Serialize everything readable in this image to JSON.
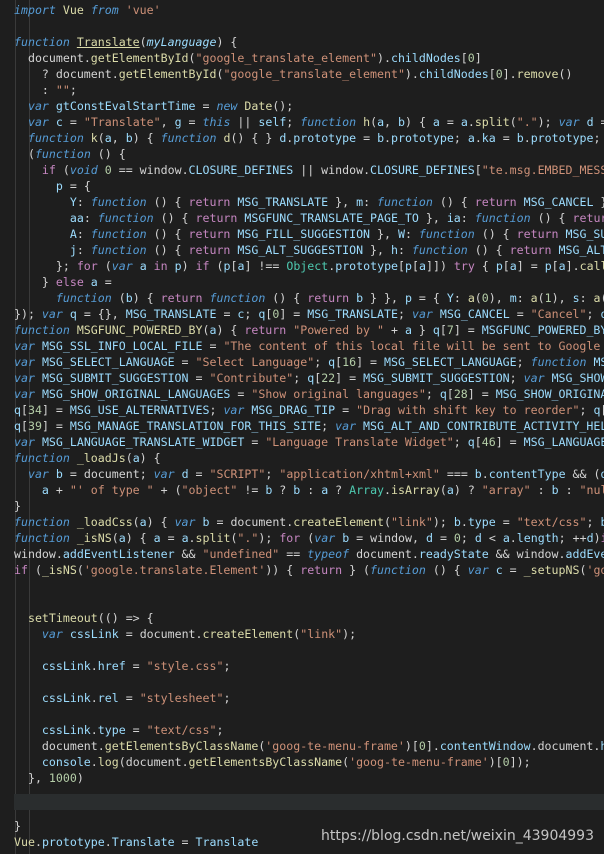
{
  "editor": {
    "language": "javascript",
    "colors": {
      "background": "#1e1e1e",
      "keyword": "#569cd6",
      "control": "#c586c0",
      "function": "#dcdcaa",
      "string": "#ce9178",
      "number": "#b5cea8",
      "variable": "#9cdcfe",
      "class": "#4ec9b0"
    },
    "lines": [
      "import Vue from 'vue'",
      "",
      "function Translate(myLanguage) {",
      "  document.getElementById(\"google_translate_element\").childNodes[0]",
      "    ? document.getElementById(\"google_translate_element\").childNodes[0].remove()",
      "    : \"\";",
      "  var gtConstEvalStartTime = new Date();",
      "  var c = \"Translate\", g = this || self; function h(a, b) { a = a.split(\".\"); var d = g; a",
      "  function k(a, b) { function d() { } d.prototype = b.prototype; a.ka = b.prototype; a.pro",
      "  (function () {",
      "    if (void 0 == window.CLOSURE_DEFINES || window.CLOSURE_DEFINES[\"te.msg.EMBED_MESSAGES\"",
      "      p = {",
      "        Y: function () { return MSG_TRANSLATE }, m: function () { return MSG_CANCEL }, s:",
      "        aa: function () { return MSGFUNC_TRANSLATE_PAGE_TO }, ia: function () { return MSG",
      "        A: function () { return MSG_FILL_SUGGESTION }, W: function () { return MSG_SUBMIT_",
      "        j: function () { return MSG_ALT_SUGGESTION }, h: function () { return MSG_ALT_ACTI",
      "      }; for (var a in p) if (p[a] !== Object.prototype[p[a]]) try { p[a] = p[a].call(null",
      "    } else a =",
      "      function (b) { return function () { return b } }, p = { Y: a(0), m: a(1), s: a(2), k",
      "}); var q = {}, MSG_TRANSLATE = c; q[0] = MSG_TRANSLATE; var MSG_CANCEL = \"Cancel\"; q[",
      "function MSGFUNC_POWERED_BY(a) { return \"Powered by \" + a } q[7] = MSGFUNC_POWERED_BY; v",
      "var MSG_SSL_INFO_LOCAL_FILE = \"The content of this local file will be sent to Google for",
      "var MSG_SELECT_LANGUAGE = \"Select Language\"; q[16] = MSG_SELECT_LANGUAGE; function MSGFU",
      "var MSG_SUBMIT_SUGGESTION = \"Contribute\"; q[22] = MSG_SUBMIT_SUGGESTION; var MSG_SHOW_TR",
      "var MSG_SHOW_ORIGINAL_LANGUAGES = \"Show original languages\"; q[28] = MSG_SHOW_ORIGINAL_L",
      "q[34] = MSG_USE_ALTERNATIVES; var MSG_DRAG_TIP = \"Drag with shift key to reorder\"; q[35]",
      "q[39] = MSG_MANAGE_TRANSLATION_FOR_THIS_SITE; var MSG_ALT_AND_CONTRIBUTE_ACTIVITY_HELPER",
      "var MSG_LANGUAGE_TRANSLATE_WIDGET = \"Language Translate Widget\"; q[46] = MSG_LANGUAGE_TR",
      "function _loadJs(a) {",
      "  var b = document; var d = \"SCRIPT\"; \"application/xhtml+xml\" === b.contentType && (d = ",
      "    a + \"' of type \" + (\"object\" != b ? b : a ? Array.isArray(a) ? \"array\" : b : \"null\")",
      "}",
      "function _loadCss(a) { var b = document.createElement(\"link\"); b.type = \"text/css\"; b.re",
      "function _isNS(a) { a = a.split(\".\"); for (var b = window, d = 0; d < a.length; ++d)if (",
      "window.addEventListener && \"undefined\" == typeof document.readyState && window.addEventL",
      "if (_isNS('google.translate.Element')) { return } (function () { var c = _setupNS('googl",
      "",
      "",
      "  setTimeout(() => {",
      "    var cssLink = document.createElement(\"link\");",
      "",
      "    cssLink.href = \"style.css\";",
      "",
      "    cssLink.rel = \"stylesheet\";",
      "",
      "    cssLink.type = \"text/css\";",
      "    document.getElementsByClassName('goog-te-menu-frame')[0].contentWindow.document.head.a",
      "    console.log(document.getElementsByClassName('goog-te-menu-frame')[0]);",
      "  }, 1000)",
      "",
      "",
      "}",
      "Vue.prototype.Translate = Translate"
    ]
  },
  "watermark": "https://blog.csdn.net/weixin_43904993"
}
